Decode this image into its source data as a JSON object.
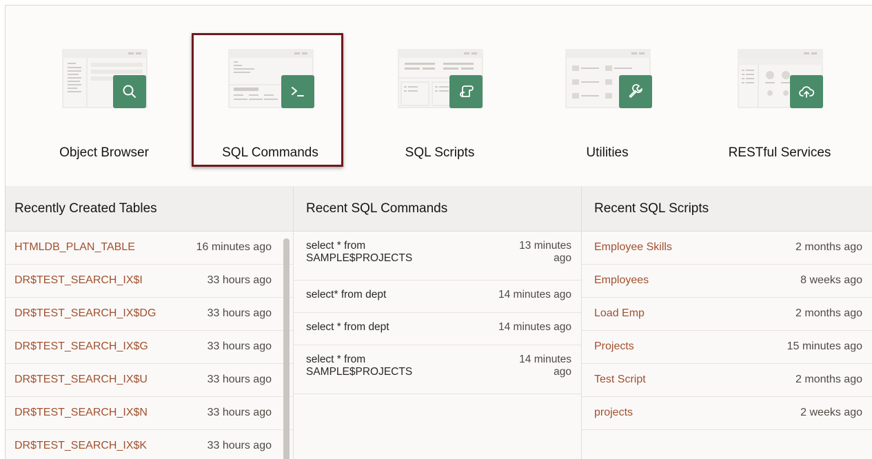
{
  "tiles": [
    {
      "label": "Object Browser",
      "icon": "search-icon"
    },
    {
      "label": "SQL Commands",
      "icon": "terminal-icon",
      "selected": true
    },
    {
      "label": "SQL Scripts",
      "icon": "script-scroll-icon"
    },
    {
      "label": "Utilities",
      "icon": "wrench-icon"
    },
    {
      "label": "RESTful Services",
      "icon": "cloud-upload-icon"
    }
  ],
  "colors": {
    "badge": "#4a8c6a",
    "link": "#a0502e",
    "selection_border": "#6e1a1d"
  },
  "recent_tables": {
    "title": "Recently Created Tables",
    "rows": [
      {
        "name": "HTMLDB_PLAN_TABLE",
        "time": "16 minutes ago"
      },
      {
        "name": "DR$TEST_SEARCH_IX$I",
        "time": "33 hours ago"
      },
      {
        "name": "DR$TEST_SEARCH_IX$DG",
        "time": "33 hours ago"
      },
      {
        "name": "DR$TEST_SEARCH_IX$G",
        "time": "33 hours ago"
      },
      {
        "name": "DR$TEST_SEARCH_IX$U",
        "time": "33 hours ago"
      },
      {
        "name": "DR$TEST_SEARCH_IX$N",
        "time": "33 hours ago"
      },
      {
        "name": "DR$TEST_SEARCH_IX$K",
        "time": "33 hours ago"
      }
    ]
  },
  "recent_commands": {
    "title": "Recent SQL Commands",
    "rows": [
      {
        "name": "select * from SAMPLE$PROJECTS",
        "time": "13 minutes ago"
      },
      {
        "name": "select* from dept",
        "time": "14 minutes ago"
      },
      {
        "name": "select * from dept",
        "time": "14 minutes ago"
      },
      {
        "name": "select * from SAMPLE$PROJECTS",
        "time": "14 minutes ago"
      }
    ]
  },
  "recent_scripts": {
    "title": "Recent SQL Scripts",
    "rows": [
      {
        "name": "Employee Skills",
        "time": "2 months ago"
      },
      {
        "name": "Employees",
        "time": "8 weeks ago"
      },
      {
        "name": "Load Emp",
        "time": "2 months ago"
      },
      {
        "name": "Projects",
        "time": "15 minutes ago"
      },
      {
        "name": "Test Script",
        "time": "2 months ago"
      },
      {
        "name": "projects",
        "time": "2 weeks ago"
      }
    ]
  }
}
